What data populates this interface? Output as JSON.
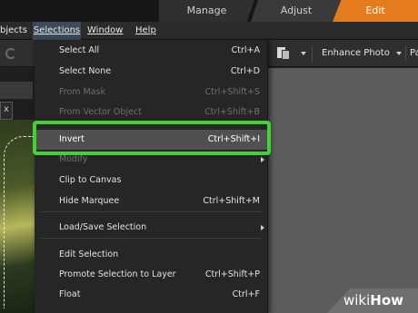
{
  "mode_tabs": [
    "Manage",
    "Adjust",
    "Edit"
  ],
  "menubar": {
    "objects": "bjects",
    "selections": "Selections",
    "window": "Window",
    "help": "Help"
  },
  "toolbar": {
    "enhance": "Enhance Photo",
    "truncated": "Pa"
  },
  "left_panel": {
    "close": "x"
  },
  "selections_menu": [
    {
      "label": "Select All",
      "shortcut": "Ctrl+A",
      "enabled": true
    },
    {
      "label": "Select None",
      "shortcut": "Ctrl+D",
      "enabled": true
    },
    {
      "label": "From Mask",
      "shortcut": "Ctrl+Shift+S",
      "enabled": false
    },
    {
      "label": "From Vector Object",
      "shortcut": "Ctrl+Shift+B",
      "enabled": false
    },
    {
      "label": "Invert",
      "shortcut": "Ctrl+Shift+I",
      "enabled": true,
      "highlighted": true
    },
    {
      "label": "Modify",
      "shortcut": "",
      "enabled": false,
      "submenu": true
    },
    {
      "label": "Clip to Canvas",
      "shortcut": "",
      "enabled": true
    },
    {
      "label": "Hide Marquee",
      "shortcut": "Ctrl+Shift+M",
      "enabled": true
    },
    {
      "label": "Load/Save Selection",
      "shortcut": "",
      "enabled": true,
      "submenu": true
    },
    {
      "label": "Edit Selection",
      "shortcut": "",
      "enabled": true
    },
    {
      "label": "Promote Selection to Layer",
      "shortcut": "Ctrl+Shift+P",
      "enabled": true
    },
    {
      "label": "Float",
      "shortcut": "Ctrl+F",
      "enabled": true
    }
  ],
  "colors": {
    "accent_edit": "#e47b1c",
    "highlight": "#3fd434"
  },
  "watermark": {
    "wiki": "wiki",
    "how": "How"
  }
}
